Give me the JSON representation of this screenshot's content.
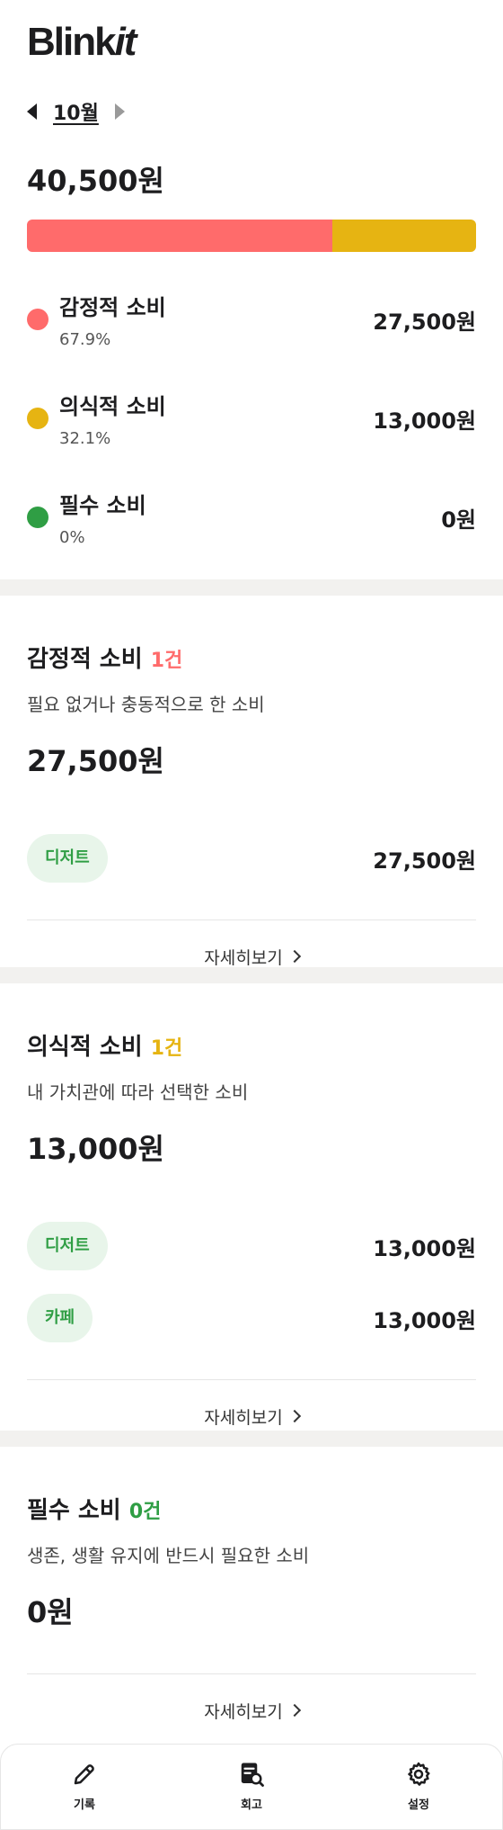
{
  "app": {
    "logo": "Blinkit",
    "logo_prefix": "Blink",
    "logo_suffix": "it"
  },
  "month_nav": {
    "month": "10월"
  },
  "total": "40,500원",
  "breakdown_bar": [
    {
      "key": "emotional",
      "share": 0.679,
      "color": "#ff6b6b"
    },
    {
      "key": "conscious",
      "share": 0.321,
      "color": "#e6b412"
    },
    {
      "key": "essential",
      "share": 0.0,
      "color": "#2f9e44"
    }
  ],
  "categories": [
    {
      "name": "감정적 소비",
      "percent": "67.9%",
      "amount": "27,500원",
      "color": "#ff6b6b"
    },
    {
      "name": "의식적 소비",
      "percent": "32.1%",
      "amount": "13,000원",
      "color": "#e6b412"
    },
    {
      "name": "필수 소비",
      "percent": "0%",
      "amount": "0원",
      "color": "#2f9e44"
    }
  ],
  "sections": {
    "emotional": {
      "title": "감정적 소비",
      "count": "1건",
      "count_color": "#ff6b6b",
      "description": "필요 없거나 충동적으로 한 소비",
      "total": "27,500원",
      "items": [
        {
          "tag": "디저트",
          "amount": "27,500원"
        }
      ],
      "more": "자세히보기"
    },
    "conscious": {
      "title": "의식적 소비",
      "count": "1건",
      "count_color": "#e6b412",
      "description": "내 가치관에 따라 선택한 소비",
      "total": "13,000원",
      "items": [
        {
          "tag": "디저트",
          "amount": "13,000원"
        },
        {
          "tag": "카페",
          "amount": "13,000원"
        }
      ],
      "more": "자세히보기"
    },
    "essential": {
      "title": "필수 소비",
      "count": "0건",
      "count_color": "#2f9e44",
      "description": "생존, 생활 유지에 반드시 필요한 소비",
      "total": "0원",
      "items": [],
      "more": "자세히보기"
    }
  },
  "tabbar": [
    {
      "label": "기록",
      "icon": "pencil-icon"
    },
    {
      "label": "회고",
      "icon": "report-search-icon"
    },
    {
      "label": "설정",
      "icon": "gear-icon"
    }
  ]
}
